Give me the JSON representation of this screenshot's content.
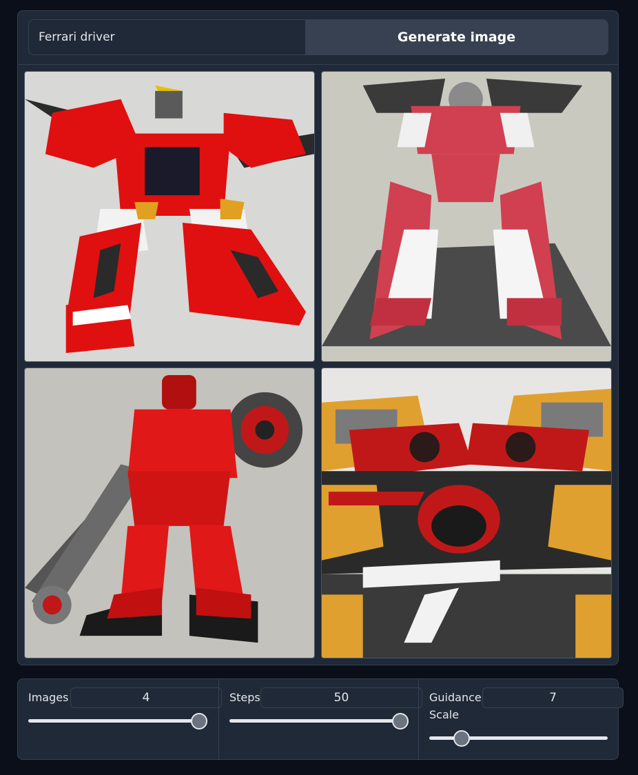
{
  "prompt": {
    "value": "Ferrari driver",
    "button_label": "Generate image"
  },
  "gallery": {
    "images": [
      {
        "icon": "red-white-mecha-robot-image"
      },
      {
        "icon": "red-grey-gundam-robot-image"
      },
      {
        "icon": "red-robot-with-cannon-image"
      },
      {
        "icon": "yellow-red-mecha-machinery-image"
      }
    ]
  },
  "controls": {
    "images": {
      "label": "Images",
      "value": "4",
      "level": 1.0
    },
    "steps": {
      "label": "Steps",
      "value": "50",
      "level": 1.0
    },
    "guidance": {
      "label": "Guidance Scale",
      "value": "7",
      "level": 0.18
    }
  },
  "colors": {
    "background": "#0b0f19",
    "panel": "#1f2937",
    "border": "#374151",
    "button": "#374151"
  }
}
